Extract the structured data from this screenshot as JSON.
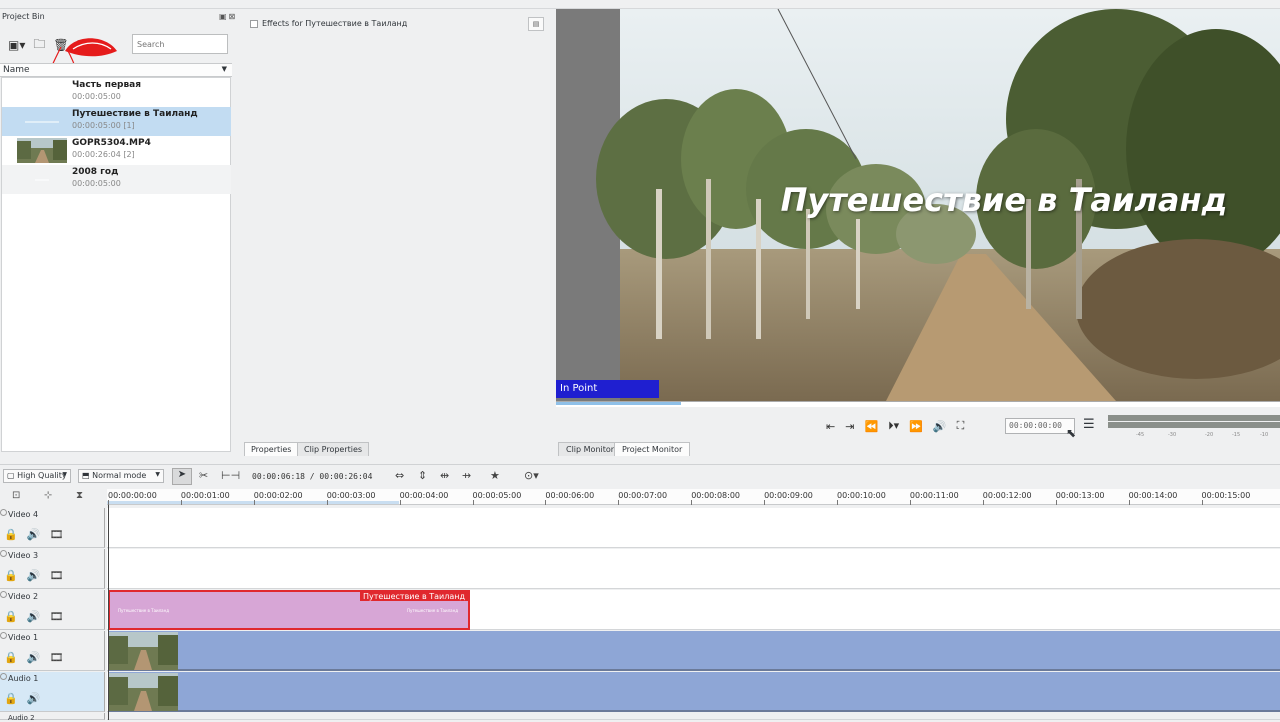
{
  "project_bin": {
    "title": "Project Bin",
    "window_buttons": "▣⊠",
    "search_placeholder": "Search",
    "column_header": "Name",
    "items": [
      {
        "name": "Часть первая",
        "meta": "00:00:05:00"
      },
      {
        "name": "Путешествие в Таиланд",
        "meta": "00:00:05:00  [1]"
      },
      {
        "name": "GOPR5304.MP4",
        "meta": "00:00:26:04  [2]"
      },
      {
        "name": "2008 год",
        "meta": "00:00:05:00"
      }
    ]
  },
  "effects": {
    "title": "Effects for Путешествие в Таиланд",
    "tabs": [
      "Properties",
      "Clip Properties"
    ]
  },
  "monitor": {
    "overlay_title": "Путешествие в Таиланд",
    "in_point_label": "In Point",
    "timecode": "00:00:00:00",
    "tabs": [
      "Clip Monitor",
      "Project Monitor"
    ],
    "meter_labels": [
      "-45",
      "-30",
      "-20",
      "-15",
      "-10"
    ]
  },
  "timeline_toolbar": {
    "quality": "High Quality",
    "mode": "Normal mode",
    "timecode": "00:00:06:18 / 00:00:26:04"
  },
  "ruler": {
    "ticks": [
      "00:00:00:00",
      "00:00:01:00",
      "00:00:02:00",
      "00:00:03:00",
      "00:00:04:00",
      "00:00:05:00",
      "00:00:06:00",
      "00:00:07:00",
      "00:00:08:00",
      "00:00:09:00",
      "00:00:10:00",
      "00:00:11:00",
      "00:00:12:00",
      "00:00:13:00",
      "00:00:14:00",
      "00:00:15:00"
    ]
  },
  "tracks": [
    "Video 4",
    "Video 3",
    "Video 2",
    "Video 1",
    "Audio 1",
    "Audio 2"
  ],
  "clips": {
    "title_clip_label": "Путешествие в Таиланд",
    "title_clip_mini": "Путешествие в Таиланд"
  },
  "colors": {
    "accent": "#3daee9",
    "selection": "#c2dcf2",
    "clip_title": "#d7a6d6",
    "clip_video": "#8ea6d6",
    "clip_selected_border": "#e0282e",
    "in_point": "#1f1fd0"
  }
}
